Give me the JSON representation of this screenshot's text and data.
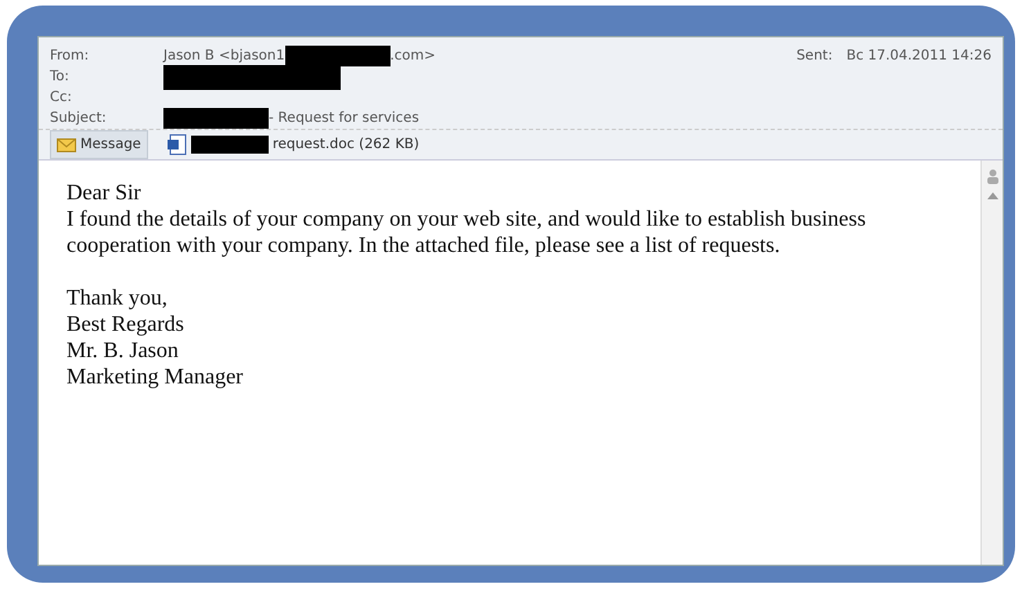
{
  "header": {
    "fields": [
      {
        "label": "From:",
        "parts": [
          {
            "text": "Jason B <bjason1"
          },
          {
            "kind": "redaction"
          },
          {
            "text": ".com>"
          }
        ]
      },
      {
        "label": "To:",
        "parts": [
          {
            "kind": "redaction"
          }
        ]
      },
      {
        "label": "Cc:"
      },
      {
        "label": "Subject:",
        "parts": [
          {
            "kind": "redaction"
          },
          {
            "text": "- Request for services"
          }
        ]
      }
    ],
    "sent": {
      "label": "Sent:",
      "value": "Bc 17.04.2011 14:26"
    }
  },
  "tabs": [
    {
      "kind": "message",
      "label": "Message",
      "selected": true
    },
    {
      "kind": "attachment",
      "redacted": true,
      "label": "request.doc (262 KB)",
      "selected": false
    }
  ],
  "body": [
    {
      "lines": [
        "Dear Sir",
        "I found the details of your company on your web site, and would like to establish business cooperation with your company. In the attached file, please see a list of requests."
      ]
    },
    {
      "lines": [
        "Thank you,",
        "Best Regards",
        "Mr. B. Jason",
        "Marketing Manager"
      ]
    }
  ]
}
